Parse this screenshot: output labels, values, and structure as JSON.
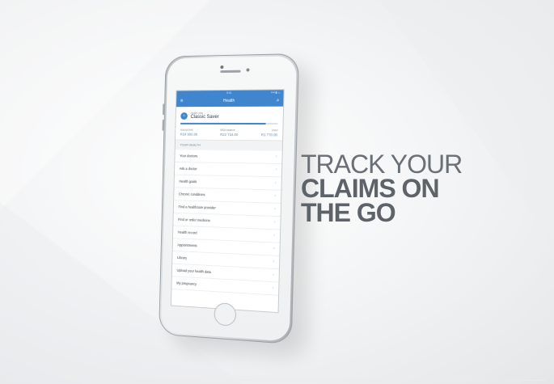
{
  "phone_screen": {
    "status_time": "9:41",
    "status_signal": "▾ ▾ ▮ ▭",
    "appbar_title": "Health",
    "menu_glyph": "≡",
    "search_glyph": "⌕",
    "plan_icon_glyph": "⌂",
    "plan_label": "Health plan",
    "plan_name": "Classic Saver",
    "stats": [
      {
        "label": "Annual limit",
        "value": "R34 900.00"
      },
      {
        "label": "MSA balance",
        "value": "R22 734.00"
      },
      {
        "label": "Used",
        "value": "R1 770.00"
      }
    ],
    "section_heading": "YOUR HEALTH",
    "menu_items": [
      "Your doctors",
      "Ask a doctor",
      "Health goals",
      "Chronic conditions",
      "Find a healthcare provider",
      "Find or order medicine",
      "Health record",
      "Appointments",
      "Library",
      "Upload your health data",
      "My pregnancy"
    ],
    "chevron": "›",
    "accent_color": "#3f86cf"
  },
  "headline": {
    "line1": "TRACK YOUR",
    "line2": "CLAIMS ON",
    "line3": "THE GO"
  }
}
